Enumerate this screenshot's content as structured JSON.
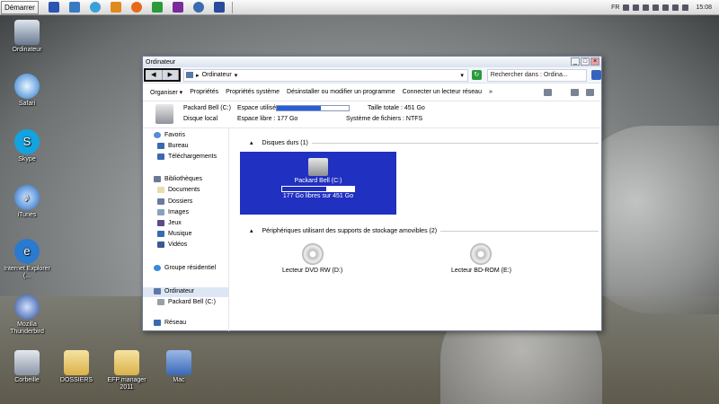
{
  "taskbar": {
    "start": "Démarrer",
    "lang": "FR",
    "clock": "15:08"
  },
  "desktop": {
    "icons": [
      "Ordinateur",
      "Safari",
      "Skype",
      "iTunes",
      "Internet Explorer (...",
      "Mozilla Thunderbird",
      "Corbeille",
      "DOSSIERS",
      "EFP manager 2011",
      "Mac"
    ]
  },
  "window": {
    "title": "Ordinateur",
    "address": "Ordinateur",
    "search_placeholder": "Rechercher dans : Ordina...",
    "toolbar": [
      "Organiser",
      "Propriétés",
      "Propriétés système",
      "Désinstaller ou modifier un programme",
      "Connecter un lecteur réseau",
      "»"
    ],
    "info": {
      "drive": "Packard Bell (C:)",
      "drive_type": "Disque local",
      "used_label": "Espace utilisé :",
      "free": "Espace libre : 177 Go",
      "total": "Taille totale : 451 Go",
      "fs": "Système de fichiers : NTFS",
      "used_fraction": 0.61
    },
    "nav": {
      "favoris": "Favoris",
      "bureau": "Bureau",
      "telechargements": "Téléchargements",
      "bibliotheques": "Bibliothèques",
      "documents": "Documents",
      "dossiers": "Dossiers",
      "images": "Images",
      "jeux": "Jeux",
      "musique": "Musique",
      "videos": "Vidéos",
      "groupe": "Groupe résidentiel",
      "ordinateur": "Ordinateur",
      "packard": "Packard Bell (C:)",
      "reseau": "Réseau"
    },
    "groups": {
      "hdd": "Disques durs (1)",
      "removable": "Périphériques utilisant des supports de stockage amovibles (2)"
    },
    "drive_tile": {
      "name": "Packard Bell (C:)",
      "caption": "177 Go libres sur 451 Go",
      "free_fraction": 0.39
    },
    "devices": [
      "Lecteur DVD RW (D:)",
      "Lecteur BD-ROM (E:)"
    ]
  },
  "colors": {
    "selection": "#2030c0",
    "usage": "#2a5ed8"
  }
}
